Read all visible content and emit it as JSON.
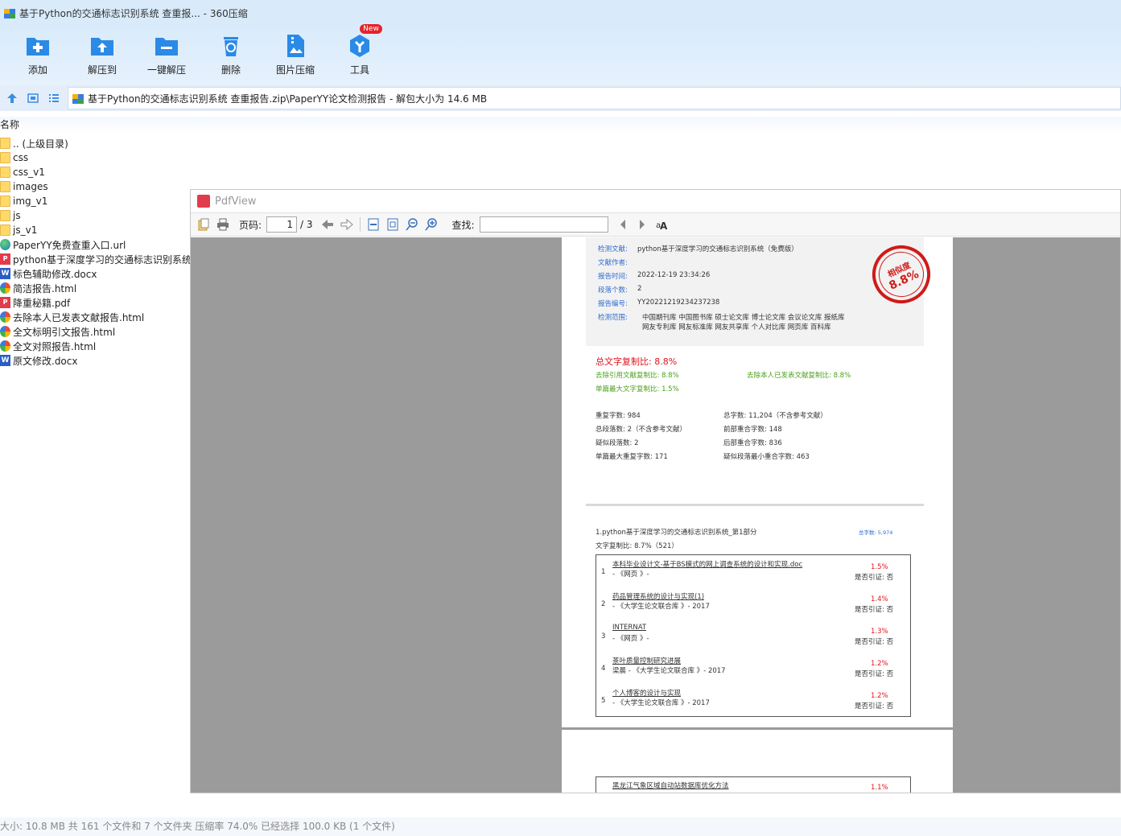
{
  "window": {
    "title": "基于Python的交通标志识别系统 查重报... - 360压缩"
  },
  "toolbar": {
    "buttons": [
      {
        "label": "添加",
        "icon": "add-icon"
      },
      {
        "label": "解压到",
        "icon": "extract-to-icon"
      },
      {
        "label": "一键解压",
        "icon": "one-click-extract-icon"
      },
      {
        "label": "删除",
        "icon": "delete-icon"
      },
      {
        "label": "图片压缩",
        "icon": "image-compress-icon"
      },
      {
        "label": "工具",
        "icon": "tools-icon",
        "badge": "New"
      }
    ]
  },
  "address": {
    "path": "基于Python的交通标志识别系统 查重报告.zip\\PaperYY论文检测报告 - 解包大小为 14.6 MB"
  },
  "list": {
    "column_name": "名称",
    "items": [
      {
        "name": ".. (上级目录)",
        "type": "folder"
      },
      {
        "name": "css",
        "type": "folder"
      },
      {
        "name": "css_v1",
        "type": "folder"
      },
      {
        "name": "images",
        "type": "folder"
      },
      {
        "name": "img_v1",
        "type": "folder"
      },
      {
        "name": "js",
        "type": "folder"
      },
      {
        "name": "js_v1",
        "type": "folder"
      },
      {
        "name": "PaperYY免费查重入口.url",
        "type": "url"
      },
      {
        "name": "python基于深度学习的交通标志识别系统",
        "type": "pdf"
      },
      {
        "name": "标色辅助修改.docx",
        "type": "doc"
      },
      {
        "name": "简洁报告.html",
        "type": "html"
      },
      {
        "name": "降重秘籍.pdf",
        "type": "pdf"
      },
      {
        "name": "去除本人已发表文献报告.html",
        "type": "html"
      },
      {
        "name": "全文标明引文报告.html",
        "type": "html"
      },
      {
        "name": "全文对照报告.html",
        "type": "html"
      },
      {
        "name": "原文修改.docx",
        "type": "doc"
      }
    ]
  },
  "status": {
    "text": "大小: 10.8 MB 共 161 个文件和 7 个文件夹 压缩率 74.0% 已经选择 100.0 KB (1 个文件)"
  },
  "pdfview": {
    "title": "PdfView",
    "page_label": "页码:",
    "page_current": "1",
    "page_total": "/ 3",
    "find_label": "查找:",
    "doc": {
      "f_doc_label": "检测文献:",
      "f_doc_value": "python基于深度学习的交通标志识别系统（免费版）",
      "f_author_label": "文献作者:",
      "f_time_label": "报告时间:",
      "f_time_value": "2022-12-19 23:34:26",
      "f_para_label": "段落个数:",
      "f_para_value": "2",
      "f_no_label": "报告编号:",
      "f_no_value": "YY20221219234237238",
      "f_range_label": "检测范围:",
      "f_range_line1": "中国期刊库 中国图书库 硕士论文库 博士论文库 会议论文库 报纸库",
      "f_range_line2": "网友专利库 网友标准库 网友共享库 个人对比库 网页库 百科库",
      "stamp_text": "相似度",
      "stamp_value": "8.8%",
      "total_ratio": "总文字复制比: 8.8%",
      "excl_quote": "去除引用文献复制比: 8.8%",
      "excl_self": "去除本人已发表文献复制比: 8.8%",
      "single_max": "单篇最大文字复制比: 1.5%",
      "stat_dup": "重复字数: 984",
      "stat_total": "总字数: 11,204（不含参考文献）",
      "stat_paras": "总段落数: 2（不含参考文献）",
      "stat_front": "前部重合字数: 148",
      "stat_sim_paras": "疑似段落数: 2",
      "stat_back": "后部重合字数: 836",
      "stat_single_max": "单篇最大重复字数: 171",
      "stat_min_overlap": "疑似段落最小重合字数: 463",
      "section_title": "1.python基于深度学习的交通标志识别系统_第1部分",
      "section_words": "总字数: 5,974",
      "section_ratio": "文字复制比: 8.7%（521）",
      "sources": [
        {
          "n": "1",
          "title": "本科毕业设计文-基于BS模式的网上调查系统的设计和实现.doc",
          "sub": "- 《网页 》-",
          "pct": "1.5%",
          "cite": "是否引证: 否"
        },
        {
          "n": "2",
          "title": "药品管理系统的设计与实现(1)",
          "sub": "- 《大学生论文联合库 》- 2017",
          "pct": "1.4%",
          "cite": "是否引证: 否"
        },
        {
          "n": "3",
          "title": "INTERNAT",
          "sub": "- 《网页 》-",
          "pct": "1.3%",
          "cite": "是否引证: 否"
        },
        {
          "n": "4",
          "title": "茶叶质量控制研究进展",
          "sub": "梁晨 - 《大学生论文联合库 》- 2017",
          "pct": "1.2%",
          "cite": "是否引证: 否"
        },
        {
          "n": "5",
          "title": "个人博客的设计与实现",
          "sub": "- 《大学生论文联合库 》- 2017",
          "pct": "1.2%",
          "cite": "是否引证: 否"
        }
      ],
      "page2_source": {
        "title": "黑龙江气象区域自动站数据库优化方法",
        "pct": "1.1%"
      }
    }
  }
}
